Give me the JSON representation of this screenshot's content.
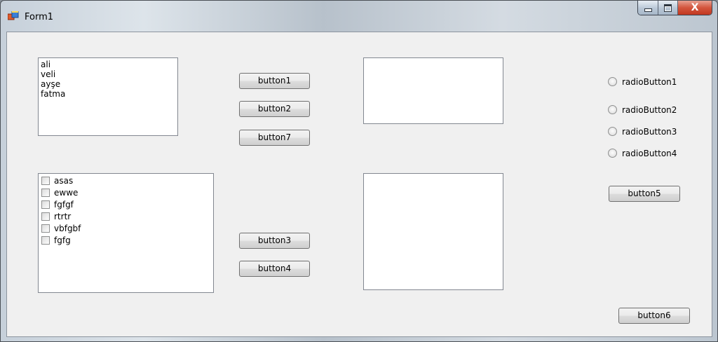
{
  "window": {
    "title": "Form1"
  },
  "listbox": {
    "items": [
      "ali",
      "veli",
      "ayşe",
      "fatma"
    ]
  },
  "checklist": {
    "items": [
      "asas",
      "ewwe",
      "fgfgf",
      "rtrtr",
      "vbfgbf",
      "fgfg"
    ]
  },
  "buttons": {
    "button1": "button1",
    "button2": "button2",
    "button7": "button7",
    "button3": "button3",
    "button4": "button4",
    "button5": "button5",
    "button6": "button6"
  },
  "radios": [
    "radioButton1",
    "radioButton2",
    "radioButton3",
    "radioButton4"
  ],
  "icons": {
    "app": "form-app-icon",
    "minimize": "minimize-icon",
    "maximize": "maximize-icon",
    "close": "close-icon"
  },
  "colors": {
    "client_bg": "#f0f0f0",
    "close_button": "#c2371f",
    "border": "#828790"
  }
}
